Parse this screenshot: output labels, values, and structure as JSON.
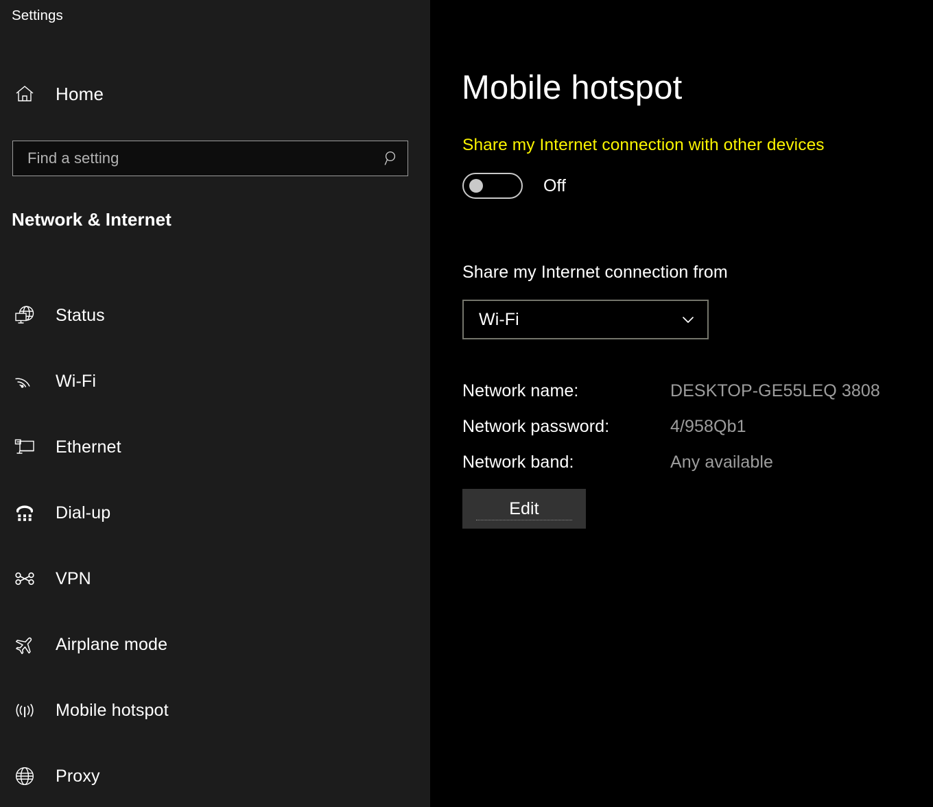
{
  "app": {
    "title": "Settings"
  },
  "sidebar": {
    "home": {
      "label": "Home",
      "icon": "home-icon"
    },
    "search": {
      "value": "",
      "placeholder": "Find a setting",
      "icon": "search-icon"
    },
    "category": "Network & Internet",
    "items": [
      {
        "label": "Status",
        "icon": "globe-monitor-icon"
      },
      {
        "label": "Wi-Fi",
        "icon": "wifi-icon"
      },
      {
        "label": "Ethernet",
        "icon": "ethernet-icon"
      },
      {
        "label": "Dial-up",
        "icon": "dialup-phone-icon"
      },
      {
        "label": "VPN",
        "icon": "vpn-knot-icon"
      },
      {
        "label": "Airplane mode",
        "icon": "airplane-icon"
      },
      {
        "label": "Mobile hotspot",
        "icon": "hotspot-icon"
      },
      {
        "label": "Proxy",
        "icon": "globe-icon"
      }
    ]
  },
  "main": {
    "page_title": "Mobile hotspot",
    "share_toggle": {
      "label": "Share my Internet connection with other devices",
      "state": "Off",
      "checked": false,
      "label_color": "#fbf400"
    },
    "share_from": {
      "label": "Share my Internet connection from",
      "selected": "Wi-Fi",
      "arrow_icon": "chevron-down-icon"
    },
    "details": [
      {
        "label": "Network name:",
        "value": "DESKTOP-GE55LEQ 3808"
      },
      {
        "label": "Network password:",
        "value": "4/958Qb1"
      },
      {
        "label": "Network band:",
        "value": "Any available"
      }
    ],
    "edit_button": "Edit"
  },
  "colors": {
    "sidebar_bg": "#1c1c1c",
    "main_bg": "#000000",
    "accent_yellow": "#fbf400",
    "value_gray": "#9d9d9d",
    "button_gray": "#333333",
    "dropdown_border": "#74756b"
  }
}
